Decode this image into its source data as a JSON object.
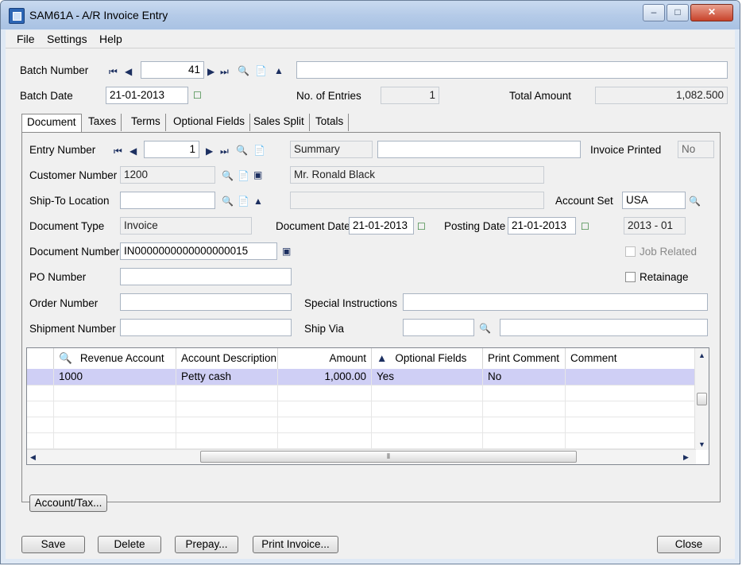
{
  "window": {
    "title": "SAM61A - A/R Invoice Entry",
    "minimize": "–",
    "maximize": "□",
    "close": "✕"
  },
  "menu": {
    "file": "File",
    "settings": "Settings",
    "help": "Help"
  },
  "batch": {
    "number_label": "Batch Number",
    "number_value": "41",
    "description": "",
    "date_label": "Batch Date",
    "date_value": "21-01-2013",
    "entries_label": "No. of Entries",
    "entries_value": "1",
    "total_label": "Total Amount",
    "total_value": "1,082.500"
  },
  "tabs": [
    "Document",
    "Taxes",
    "Terms",
    "Optional Fields",
    "Sales Split",
    "Totals"
  ],
  "entry": {
    "number_label": "Entry Number",
    "number_value": "1",
    "summary_label": "Summary",
    "summary_value": "",
    "invoice_printed_label": "Invoice Printed",
    "invoice_printed_value": "No",
    "customer_label": "Customer Number",
    "customer_value": "1200",
    "customer_name": "Mr. Ronald Black",
    "shipto_label": "Ship-To Location",
    "shipto_value": "",
    "shipto_desc": "",
    "account_set_label": "Account Set",
    "account_set_value": "USA",
    "doctype_label": "Document Type",
    "doctype_value": "Invoice",
    "docdate_label": "Document Date",
    "docdate_value": "21-01-2013",
    "postdate_label": "Posting Date",
    "postdate_value": "21-01-2013",
    "period_value": "2013 - 01",
    "docnum_label": "Document Number",
    "docnum_value": "IN0000000000000000015",
    "job_related_label": "Job Related",
    "po_label": "PO Number",
    "po_value": "",
    "retainage_label": "Retainage",
    "order_label": "Order Number",
    "order_value": "",
    "special_label": "Special Instructions",
    "special_value": "",
    "shipment_label": "Shipment Number",
    "shipment_value": "",
    "shipvia_label": "Ship Via",
    "shipvia_code": "",
    "shipvia_desc": ""
  },
  "grid": {
    "headers": [
      "Revenue Account",
      "Account Description",
      "Amount",
      "Optional Fields",
      "Print Comment",
      "Comment"
    ],
    "rows": [
      {
        "account": "1000",
        "description": "Petty cash",
        "amount": "1,000.00",
        "optional": "Yes",
        "print_comment": "No",
        "comment": ""
      }
    ]
  },
  "buttons": {
    "account_tax": "Account/Tax...",
    "save": "Save",
    "delete": "Delete",
    "prepay": "Prepay...",
    "print_invoice": "Print Invoice...",
    "close": "Close"
  },
  "colors": {
    "selected_row": "#cfcff5",
    "title_gradient": "#b5cbe8"
  }
}
